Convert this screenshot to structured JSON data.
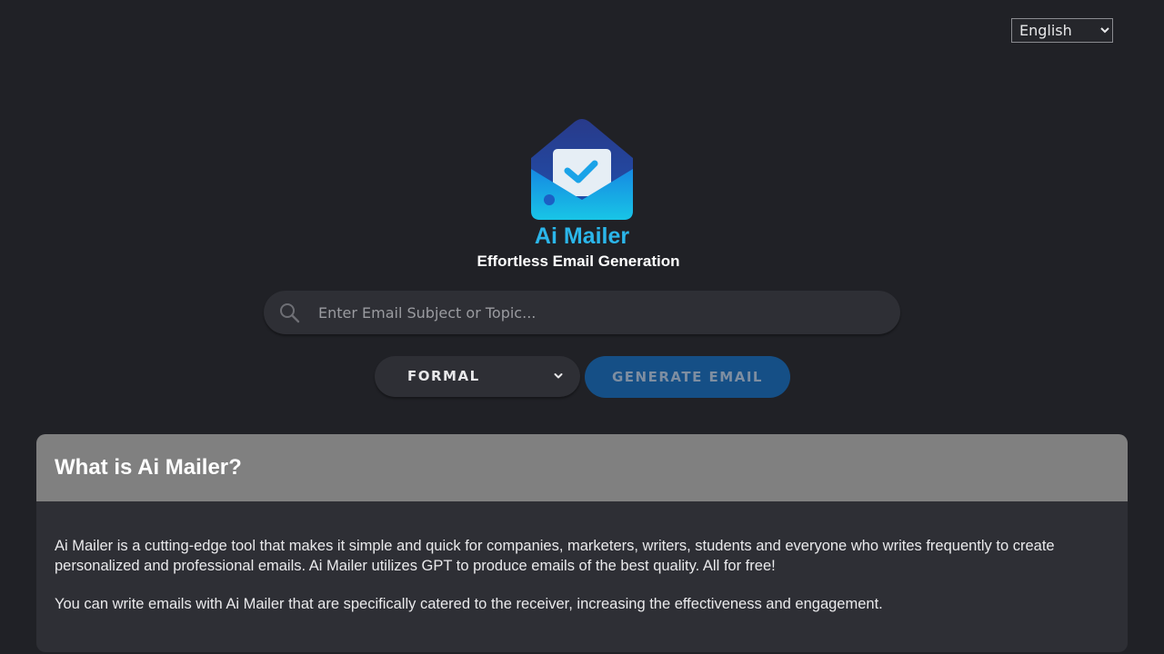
{
  "language": {
    "selected": "English"
  },
  "logo": {
    "title": "Ai Mailer",
    "tagline": "Effortless Email Generation",
    "icon": "envelope-check-icon",
    "colors": {
      "navy": "#283a8a",
      "blue": "#1689e2",
      "cyan": "#18c5e6"
    }
  },
  "search": {
    "placeholder": "Enter Email Subject or Topic...",
    "value": "",
    "icon": "search-icon"
  },
  "tone": {
    "selected": "FORMAL",
    "icon": "chevron-down-icon"
  },
  "generate": {
    "label": "GENERATE EMAIL",
    "color": "#154f86"
  },
  "about": {
    "title": "What is Ai Mailer?",
    "paragraphs": [
      "Ai Mailer is a cutting-edge tool that makes it simple and quick for companies, marketers, writers, students and everyone who writes frequently to create personalized and professional emails. Ai Mailer utilizes GPT to produce emails of the best quality. All for free!",
      "You can write emails with Ai Mailer that are specifically catered to the receiver, increasing the effectiveness and engagement."
    ]
  }
}
